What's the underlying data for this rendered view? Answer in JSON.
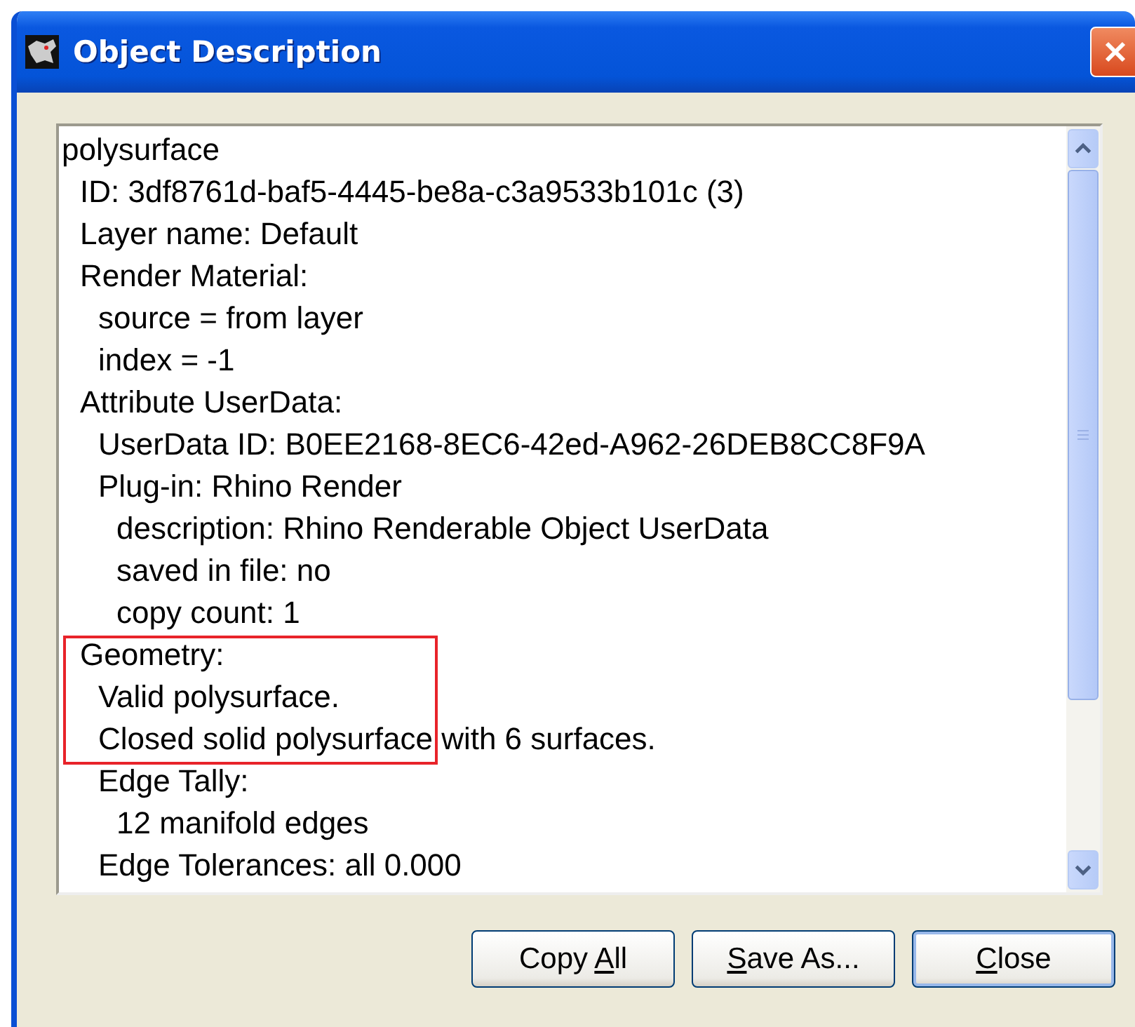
{
  "window": {
    "title": "Object Description"
  },
  "listing": [
    {
      "text": "polysurface",
      "children": [
        {
          "text": "ID: 3df8761d-baf5-4445-be8a-c3a9533b101c (3)"
        },
        {
          "text": "Layer name: Default"
        },
        {
          "text": "Render Material:",
          "children": [
            {
              "text": "source = from layer"
            },
            {
              "text": "index = -1"
            }
          ]
        },
        {
          "text": "Attribute UserData:",
          "children": [
            {
              "text": "UserData ID: B0EE2168-8EC6-42ed-A962-26DEB8CC8F9A"
            },
            {
              "text": "Plug-in: Rhino Render",
              "children": [
                {
                  "text": "description: Rhino Renderable Object UserData"
                },
                {
                  "text": "saved in file: no"
                },
                {
                  "text": "copy count: 1"
                }
              ]
            }
          ]
        },
        {
          "text": "Geometry:",
          "children": [
            {
              "text": "Valid polysurface."
            },
            {
              "text": "Closed solid polysurface with 6 surfaces."
            },
            {
              "text": "Edge Tally:",
              "children": [
                {
                  "text": "12 manifold edges"
                }
              ]
            },
            {
              "text": "Edge Tolerances: all 0.000"
            }
          ]
        }
      ]
    }
  ],
  "annotation": {
    "kind": "rectangle"
  },
  "buttons": [
    {
      "before": "Copy ",
      "mnemonic": "A",
      "after": "ll",
      "default": false
    },
    {
      "mnemonic": "S",
      "after": "ave As...",
      "default": false
    },
    {
      "mnemonic": "C",
      "after": "lose",
      "default": true
    }
  ]
}
